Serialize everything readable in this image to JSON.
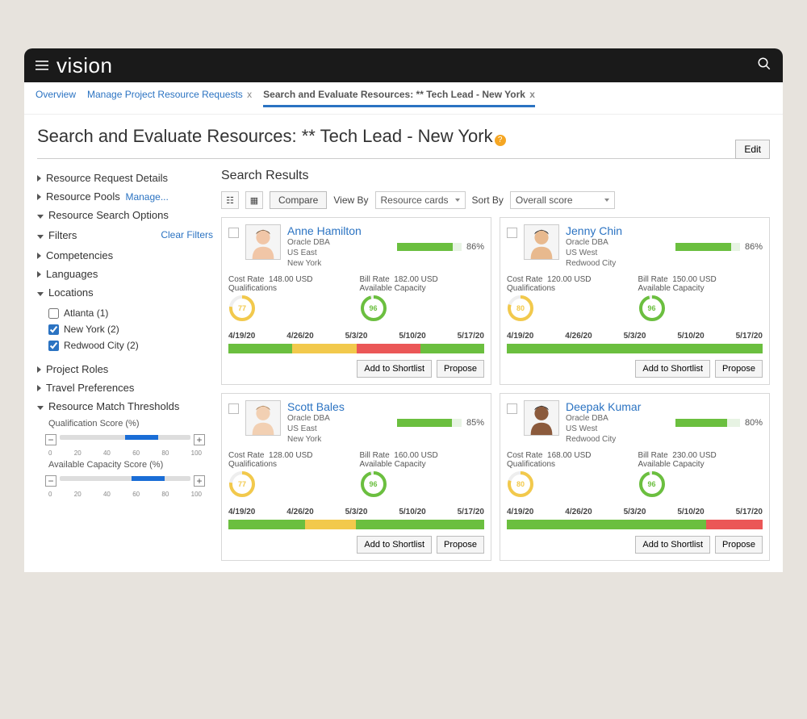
{
  "brand": "vision",
  "breadcrumb": {
    "overview": "Overview",
    "manage": "Manage Project Resource Requests",
    "current": "Search and Evaluate Resources: ** Tech Lead - New York"
  },
  "page_title": "Search and Evaluate Resources: ** Tech Lead - New York",
  "edit_label": "Edit",
  "sidebar": {
    "resource_request": "Resource Request Details",
    "resource_pools": "Resource Pools",
    "manage_link": "Manage...",
    "search_options": "Resource Search Options",
    "filters": "Filters",
    "clear_filters": "Clear Filters",
    "competencies": "Competencies",
    "languages": "Languages",
    "locations": "Locations",
    "loc_atlanta": "Atlanta (1)",
    "loc_newyork": "New York (2)",
    "loc_redwood": "Redwood City (2)",
    "project_roles": "Project Roles",
    "travel": "Travel Preferences",
    "thresholds": "Resource Match Thresholds",
    "qual_score": "Qualification Score (%)",
    "avail_score": "Available Capacity Score (%)",
    "ticks": [
      "0",
      "20",
      "40",
      "60",
      "80",
      "100"
    ]
  },
  "search_results_hdr": "Search Results",
  "toolbar": {
    "compare": "Compare",
    "viewby": "View By",
    "viewby_val": "Resource cards",
    "sortby": "Sort By",
    "sortby_val": "Overall score"
  },
  "card_labels": {
    "cost_rate": "Cost Rate",
    "bill_rate": "Bill Rate",
    "qualifications": "Qualifications",
    "available_capacity": "Available Capacity",
    "add_shortlist": "Add to Shortlist",
    "propose": "Propose"
  },
  "resources": [
    {
      "name": "Anne Hamilton",
      "role": "Oracle DBA",
      "region": "US East",
      "city": "New York",
      "cost_rate": "148.00 USD",
      "bill_rate": "182.00 USD",
      "overall_pct": "86%",
      "overall_fill": 86,
      "qual_pct": "77%",
      "qual_color": "#f2c94c",
      "avail_pct": "96%",
      "avail_color": "#6bbf3f",
      "dates": [
        "4/19/20",
        "4/26/20",
        "5/3/20",
        "5/10/20",
        "5/17/20"
      ],
      "timeline": [
        [
          "g",
          25
        ],
        [
          "y",
          25
        ],
        [
          "r",
          25
        ],
        [
          "g",
          25
        ]
      ],
      "avatar_skin": "#f1c6a7",
      "avatar_hair": "#6b4a2b"
    },
    {
      "name": "Jenny Chin",
      "role": "Oracle DBA",
      "region": "US West",
      "city": "Redwood City",
      "cost_rate": "120.00 USD",
      "bill_rate": "150.00 USD",
      "overall_pct": "86%",
      "overall_fill": 86,
      "qual_pct": "80%",
      "qual_color": "#f2c94c",
      "avail_pct": "96%",
      "avail_color": "#6bbf3f",
      "dates": [
        "4/19/20",
        "4/26/20",
        "5/3/20",
        "5/10/20",
        "5/17/20"
      ],
      "timeline": [
        [
          "g",
          100
        ]
      ],
      "avatar_skin": "#e8b98e",
      "avatar_hair": "#1a1a1a"
    },
    {
      "name": "Scott Bales",
      "role": "Oracle DBA",
      "region": "US East",
      "city": "New York",
      "cost_rate": "128.00 USD",
      "bill_rate": "160.00 USD",
      "overall_pct": "85%",
      "overall_fill": 85,
      "qual_pct": "77%",
      "qual_color": "#f2c94c",
      "avail_pct": "96%",
      "avail_color": "#6bbf3f",
      "dates": [
        "4/19/20",
        "4/26/20",
        "5/3/20",
        "5/10/20",
        "5/17/20"
      ],
      "timeline": [
        [
          "g",
          30
        ],
        [
          "y",
          20
        ],
        [
          "g",
          50
        ]
      ],
      "avatar_skin": "#f2d0b3",
      "avatar_hair": "#a87c4f"
    },
    {
      "name": "Deepak Kumar",
      "role": "Oracle DBA",
      "region": "US West",
      "city": "Redwood City",
      "cost_rate": "168.00 USD",
      "bill_rate": "230.00 USD",
      "overall_pct": "80%",
      "overall_fill": 80,
      "qual_pct": "80%",
      "qual_color": "#f2c94c",
      "avail_pct": "96%",
      "avail_color": "#6bbf3f",
      "dates": [
        "4/19/20",
        "4/26/20",
        "5/3/20",
        "5/10/20",
        "5/17/20"
      ],
      "timeline": [
        [
          "g",
          78
        ],
        [
          "r",
          22
        ]
      ],
      "avatar_skin": "#8b5a3c",
      "avatar_hair": "#1a1a1a"
    }
  ]
}
